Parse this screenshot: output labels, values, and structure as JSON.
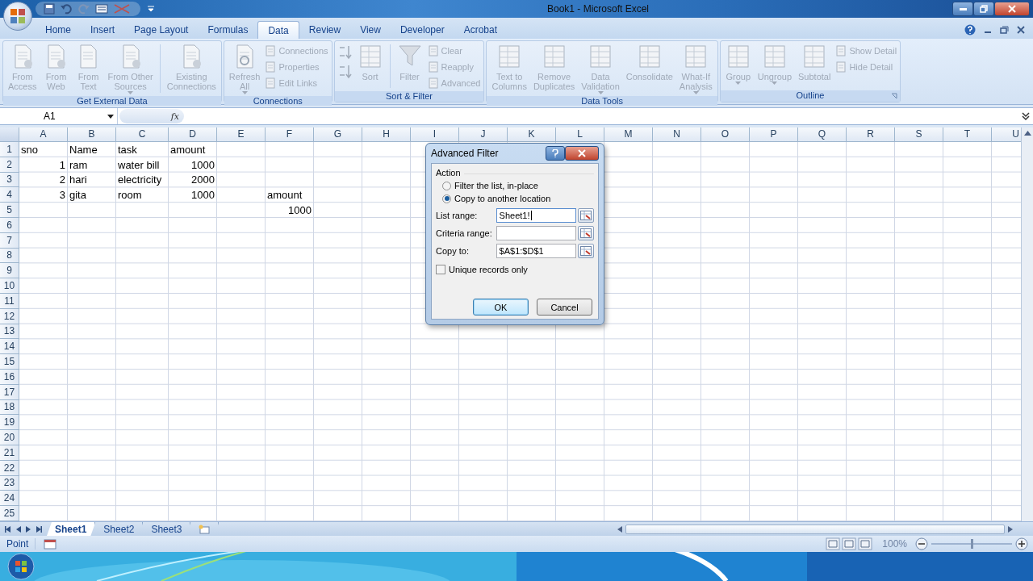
{
  "window": {
    "title": "Book1  -  Microsoft Excel"
  },
  "ribbon_tabs": [
    {
      "label": "Home",
      "selected": false
    },
    {
      "label": "Insert",
      "selected": false
    },
    {
      "label": "Page Layout",
      "selected": false
    },
    {
      "label": "Formulas",
      "selected": false
    },
    {
      "label": "Data",
      "selected": true
    },
    {
      "label": "Review",
      "selected": false
    },
    {
      "label": "View",
      "selected": false
    },
    {
      "label": "Developer",
      "selected": false
    },
    {
      "label": "Acrobat",
      "selected": false
    }
  ],
  "ribbon_groups": [
    {
      "label": "Get External Data",
      "items": [
        {
          "kind": "large",
          "lines": [
            "From",
            "Access"
          ],
          "disabled": true
        },
        {
          "kind": "large",
          "lines": [
            "From",
            "Web"
          ],
          "disabled": true
        },
        {
          "kind": "large",
          "lines": [
            "From",
            "Text"
          ],
          "disabled": true
        },
        {
          "kind": "large",
          "lines": [
            "From Other",
            "Sources"
          ],
          "dropdown": true,
          "disabled": true
        },
        {
          "kind": "separator"
        },
        {
          "kind": "large",
          "lines": [
            "Existing",
            "Connections"
          ],
          "disabled": true
        }
      ]
    },
    {
      "label": "Connections",
      "items": [
        {
          "kind": "large",
          "lines": [
            "Refresh",
            "All"
          ],
          "dropdown": true,
          "disabled": true
        },
        {
          "kind": "stack",
          "entries": [
            {
              "label": "Connections",
              "disabled": true
            },
            {
              "label": "Properties",
              "disabled": true
            },
            {
              "label": "Edit Links",
              "disabled": true
            }
          ]
        }
      ]
    },
    {
      "label": "Sort & Filter",
      "items": [
        {
          "kind": "sortpair"
        },
        {
          "kind": "large",
          "lines": [
            "Sort"
          ],
          "disabled": true
        },
        {
          "kind": "separator"
        },
        {
          "kind": "large",
          "lines": [
            "Filter"
          ],
          "disabled": true
        },
        {
          "kind": "stack",
          "entries": [
            {
              "label": "Clear",
              "disabled": true
            },
            {
              "label": "Reapply",
              "disabled": true
            },
            {
              "label": "Advanced",
              "disabled": true
            }
          ]
        }
      ]
    },
    {
      "label": "Data Tools",
      "items": [
        {
          "kind": "large",
          "lines": [
            "Text to",
            "Columns"
          ],
          "disabled": true
        },
        {
          "kind": "large",
          "lines": [
            "Remove",
            "Duplicates"
          ],
          "disabled": true
        },
        {
          "kind": "large",
          "lines": [
            "Data",
            "Validation"
          ],
          "dropdown": true,
          "disabled": true
        },
        {
          "kind": "large",
          "lines": [
            "Consolidate"
          ],
          "disabled": true
        },
        {
          "kind": "large",
          "lines": [
            "What-If",
            "Analysis"
          ],
          "dropdown": true,
          "disabled": true
        }
      ]
    },
    {
      "label": "Outline",
      "launcher": true,
      "items": [
        {
          "kind": "large",
          "lines": [
            "Group"
          ],
          "dropdown": true,
          "disabled": true
        },
        {
          "kind": "large",
          "lines": [
            "Ungroup"
          ],
          "dropdown": true,
          "disabled": true
        },
        {
          "kind": "large",
          "lines": [
            "Subtotal"
          ],
          "disabled": true
        },
        {
          "kind": "stack",
          "entries": [
            {
              "label": "Show Detail",
              "disabled": true
            },
            {
              "label": "Hide Detail",
              "disabled": true
            }
          ]
        }
      ]
    }
  ],
  "formula_bar": {
    "name_box": "A1",
    "fx": "fx"
  },
  "sheet": {
    "columns": [
      "A",
      "B",
      "C",
      "D",
      "E",
      "F",
      "G",
      "H",
      "I",
      "J",
      "K",
      "L",
      "M",
      "N",
      "O",
      "P",
      "Q",
      "R",
      "S",
      "T",
      "U"
    ],
    "rows": [
      {
        "header": "1",
        "cells": [
          "sno",
          "Name",
          "task",
          "amount"
        ]
      },
      {
        "header": "2",
        "cells": [
          "1",
          "ram",
          "water bill",
          "1000"
        ]
      },
      {
        "header": "3",
        "cells": [
          "2",
          "hari",
          "electricity",
          "2000"
        ]
      },
      {
        "header": "4",
        "cells": [
          "3",
          "gita",
          "room",
          "1000",
          "",
          "amount"
        ]
      },
      {
        "header": "5",
        "cells": [
          "",
          "",
          "",
          "",
          "",
          "1000"
        ]
      },
      {
        "header": "6",
        "cells": []
      },
      {
        "header": "7",
        "cells": []
      },
      {
        "header": "8",
        "cells": []
      },
      {
        "header": "9",
        "cells": []
      },
      {
        "header": "10",
        "cells": []
      },
      {
        "header": "11",
        "cells": []
      },
      {
        "header": "12",
        "cells": []
      },
      {
        "header": "13",
        "cells": []
      },
      {
        "header": "14",
        "cells": []
      },
      {
        "header": "15",
        "cells": []
      },
      {
        "header": "16",
        "cells": []
      },
      {
        "header": "17",
        "cells": []
      },
      {
        "header": "18",
        "cells": []
      },
      {
        "header": "19",
        "cells": []
      },
      {
        "header": "20",
        "cells": []
      },
      {
        "header": "21",
        "cells": []
      },
      {
        "header": "22",
        "cells": []
      },
      {
        "header": "23",
        "cells": []
      },
      {
        "header": "24",
        "cells": []
      },
      {
        "header": "25",
        "cells": []
      }
    ]
  },
  "dialog": {
    "title": "Advanced Filter",
    "group_label": "Action",
    "options": [
      {
        "label": "Filter the list, in-place",
        "selected": false
      },
      {
        "label": "Copy to another location",
        "selected": true
      }
    ],
    "fields": [
      {
        "label": "List range:",
        "value": "Sheet1!",
        "focused": true
      },
      {
        "label": "Criteria range:",
        "focused": false
      },
      {
        "label": "Copy to:",
        "value": "$A$1:$D$1",
        "focused": false
      }
    ],
    "checkbox": {
      "label": "Unique records only",
      "checked": false
    },
    "buttons": [
      {
        "label": "OK",
        "default": true
      },
      {
        "label": "Cancel",
        "default": false
      }
    ]
  },
  "sheet_tabs": [
    {
      "label": "Sheet1",
      "selected": true
    },
    {
      "label": "Sheet2",
      "selected": false
    },
    {
      "label": "Sheet3",
      "selected": false
    }
  ],
  "status_bar": {
    "mode": "Point",
    "zoom": "100%",
    "zoom_level": {
      "level": 0.5
    }
  }
}
